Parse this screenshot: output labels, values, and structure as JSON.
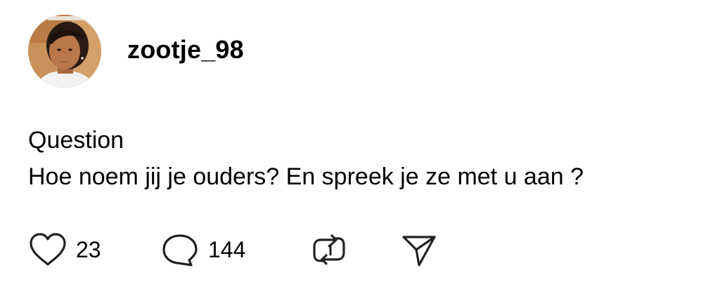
{
  "post": {
    "username": "zootje_98",
    "avatar": "profile-photo",
    "title": "Question",
    "text": "Hoe noem jij je ouders? En spreek je ze met u aan ?",
    "actions": {
      "like": {
        "icon": "heart-icon",
        "count": "23"
      },
      "comment": {
        "icon": "comment-icon",
        "count": "144"
      },
      "repost": {
        "icon": "repost-icon"
      },
      "share": {
        "icon": "send-icon"
      }
    }
  },
  "colors": {
    "background": "#ffffff",
    "text": "#000000",
    "icon": "#222222"
  }
}
